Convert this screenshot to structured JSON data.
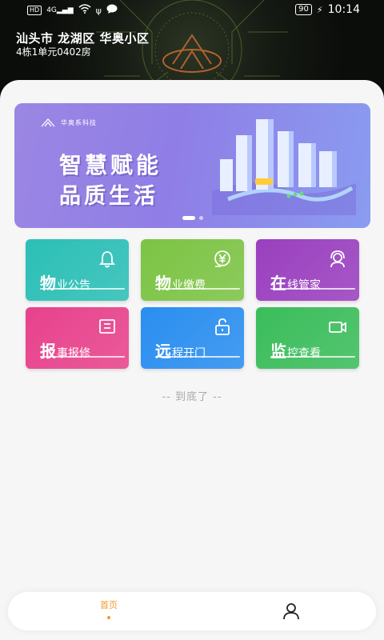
{
  "status_bar": {
    "hd": "HD",
    "network": "4G",
    "battery": "90",
    "time": "10:14"
  },
  "header": {
    "address": "汕头市 龙湖区 华奥小区",
    "room": "4栋1单元0402房"
  },
  "banner": {
    "brand": "华奥系科技",
    "line1": "智慧赋能",
    "line2": "品质生活",
    "active_page": 1,
    "page_count": 2
  },
  "services": [
    {
      "first": "物",
      "rest": "业公告",
      "icon": "bell-icon",
      "color": "#2bbfb6"
    },
    {
      "first": "物",
      "rest": "业缴费",
      "icon": "yuan-icon",
      "color": "#7cc444"
    },
    {
      "first": "在",
      "rest": "线管家",
      "icon": "headset-icon",
      "color": "#9a3fbf"
    },
    {
      "first": "报",
      "rest": "事报修",
      "icon": "report-icon",
      "color": "#e8428c"
    },
    {
      "first": "远",
      "rest": "程开门",
      "icon": "unlock-icon",
      "color": "#2a8ef0"
    },
    {
      "first": "监",
      "rest": "控查看",
      "icon": "camera-icon",
      "color": "#3bbd5b"
    }
  ],
  "end_note": "-- 到底了 --",
  "tabbar": {
    "home_label": "首页",
    "active_color": "#f39a2b",
    "user_icon": "user-icon"
  }
}
